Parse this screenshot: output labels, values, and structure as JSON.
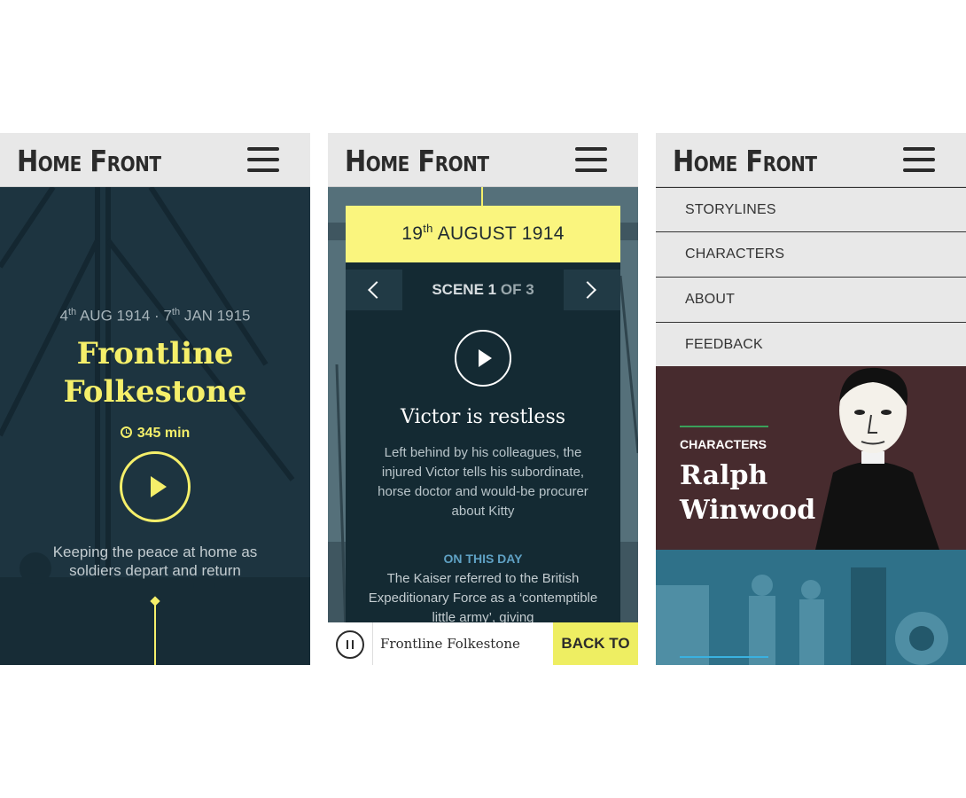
{
  "app": {
    "logo": "Home Front"
  },
  "screen1": {
    "dates": {
      "start_day": "4",
      "start_sup": "th",
      "start_rest": " AUG 1914 · 7",
      "end_sup": "th",
      "end_rest": " JAN 1915"
    },
    "title_line1": "Frontline",
    "title_line2": "Folkestone",
    "duration": "345 min",
    "description": "Keeping the peace at home as soldiers depart and return"
  },
  "screen2": {
    "date": {
      "day": "19",
      "sup": "th",
      "rest": " AUGUST 1914"
    },
    "scene": {
      "label": "SCENE",
      "current": "1",
      "of": "OF 3"
    },
    "heading": "Victor is restless",
    "body": "Left behind by his colleagues, the injured Victor tells his subordinate, horse doctor and would-be procurer about Kitty",
    "on_this_day_label": "ON THIS DAY",
    "on_this_day_text": "The Kaiser referred to the British Expeditionary Force as a ‘contemptible little army’, giving",
    "player": {
      "track": "Frontline Folkestone",
      "back_to": "BACK TO"
    }
  },
  "screen3": {
    "menu": [
      "STORYLINES",
      "CHARACTERS",
      "ABOUT",
      "FEEDBACK"
    ],
    "character_card": {
      "kicker": "CHARACTERS",
      "name_line1": "Ralph",
      "name_line2": "Winwood"
    }
  },
  "colors": {
    "accent_yellow": "#f5ef6a",
    "dark_teal": "#1d3440",
    "menu_bg": "#e8e8e8",
    "character_bg": "#472b2e",
    "on_this_day_blue": "#5fa1c4"
  }
}
